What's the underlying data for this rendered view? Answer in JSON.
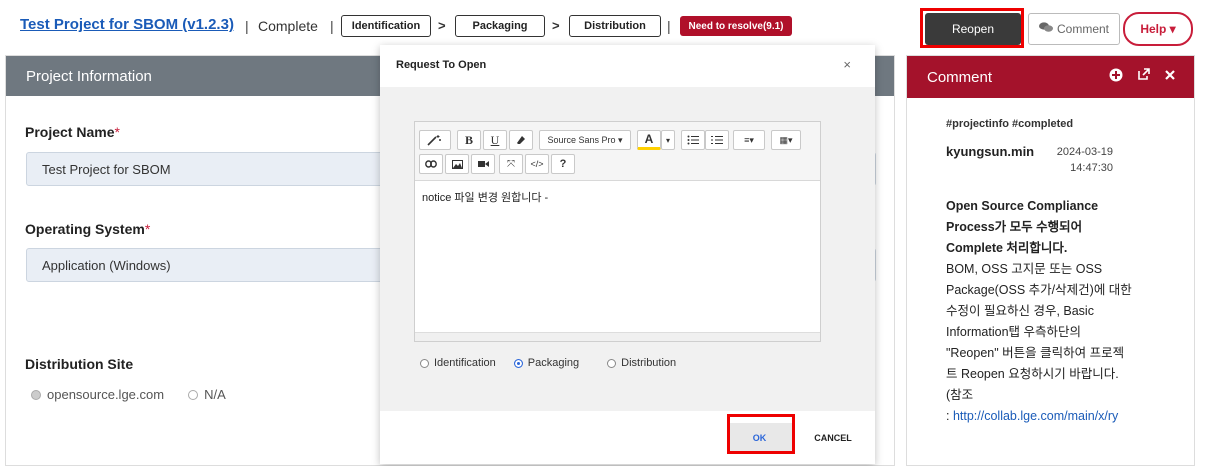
{
  "header": {
    "project_title": "Test Project for SBOM (v1.2.3)",
    "separator": "|",
    "status": "Complete",
    "stages": [
      "Identification",
      "Packaging",
      "Distribution"
    ],
    "arrow": ">",
    "resolve_badge": "Need to resolve(9.1)",
    "reopen_label": "Reopen",
    "comment_label": "Comment",
    "help_label": "Help ▾"
  },
  "project_info": {
    "title": "Project Information",
    "project_name_label": "Project Name",
    "project_name_value": "Test Project for SBOM",
    "os_label": "Operating System",
    "os_value": "Application (Windows)",
    "distribution_label": "Distribution Site",
    "distribution_options": [
      "opensource.lge.com",
      "N/A"
    ],
    "required_mark": "*"
  },
  "modal": {
    "title": "Request To Open",
    "close": "×",
    "font_select": "Source Sans Pro ▾",
    "editor_text": "notice 파일 변경 원합니다 -",
    "radio_options": [
      "Identification",
      "Packaging",
      "Distribution"
    ],
    "selected_radio": "Packaging",
    "ok_label": "OK",
    "cancel_label": "CANCEL"
  },
  "comment_panel": {
    "title": "Comment",
    "tags": "#projectinfo #completed",
    "user": "kyungsun.min",
    "date": "2024-03-19",
    "time": "14:47:30",
    "bold_lines": [
      "Open Source Compliance",
      "Process가 모두 수행되어",
      "Complete 처리합니다."
    ],
    "body_lines": [
      "BOM, OSS 고지문 또는 OSS",
      "Package(OSS 추가/삭제건)에 대한",
      "수정이 필요하신 경우, Basic",
      "Information탭 우측하단의",
      "\"Reopen\" 버튼을 클릭하여 프로젝",
      "트 Reopen 요청하시기 바랍니다.",
      "(참조"
    ],
    "link_prefix": ": ",
    "link": "http://collab.lge.com/main/x/ry"
  }
}
